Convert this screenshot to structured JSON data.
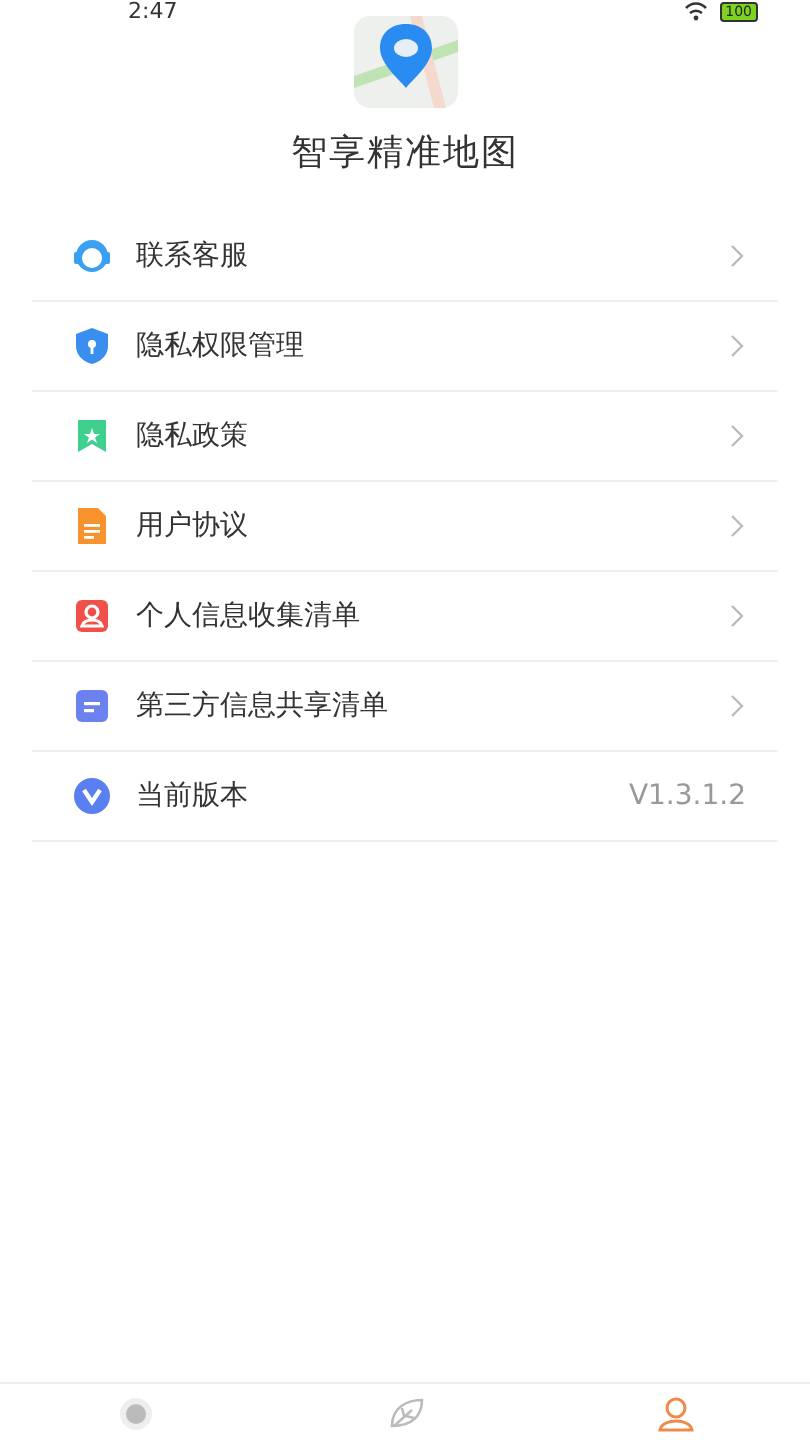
{
  "status_bar": {
    "time": "2:47",
    "battery": "100"
  },
  "app": {
    "title": "智享精准地图"
  },
  "menu": [
    {
      "label": "联系客服",
      "kind": "link"
    },
    {
      "label": "隐私权限管理",
      "kind": "link"
    },
    {
      "label": "隐私政策",
      "kind": "link"
    },
    {
      "label": "用户协议",
      "kind": "link"
    },
    {
      "label": "个人信息收集清单",
      "kind": "link"
    },
    {
      "label": "第三方信息共享清单",
      "kind": "link"
    },
    {
      "label": "当前版本",
      "kind": "value",
      "value": "V1.3.1.2"
    }
  ],
  "tab_bar": [
    {
      "selected": false
    },
    {
      "selected": false
    },
    {
      "selected": true
    }
  ]
}
